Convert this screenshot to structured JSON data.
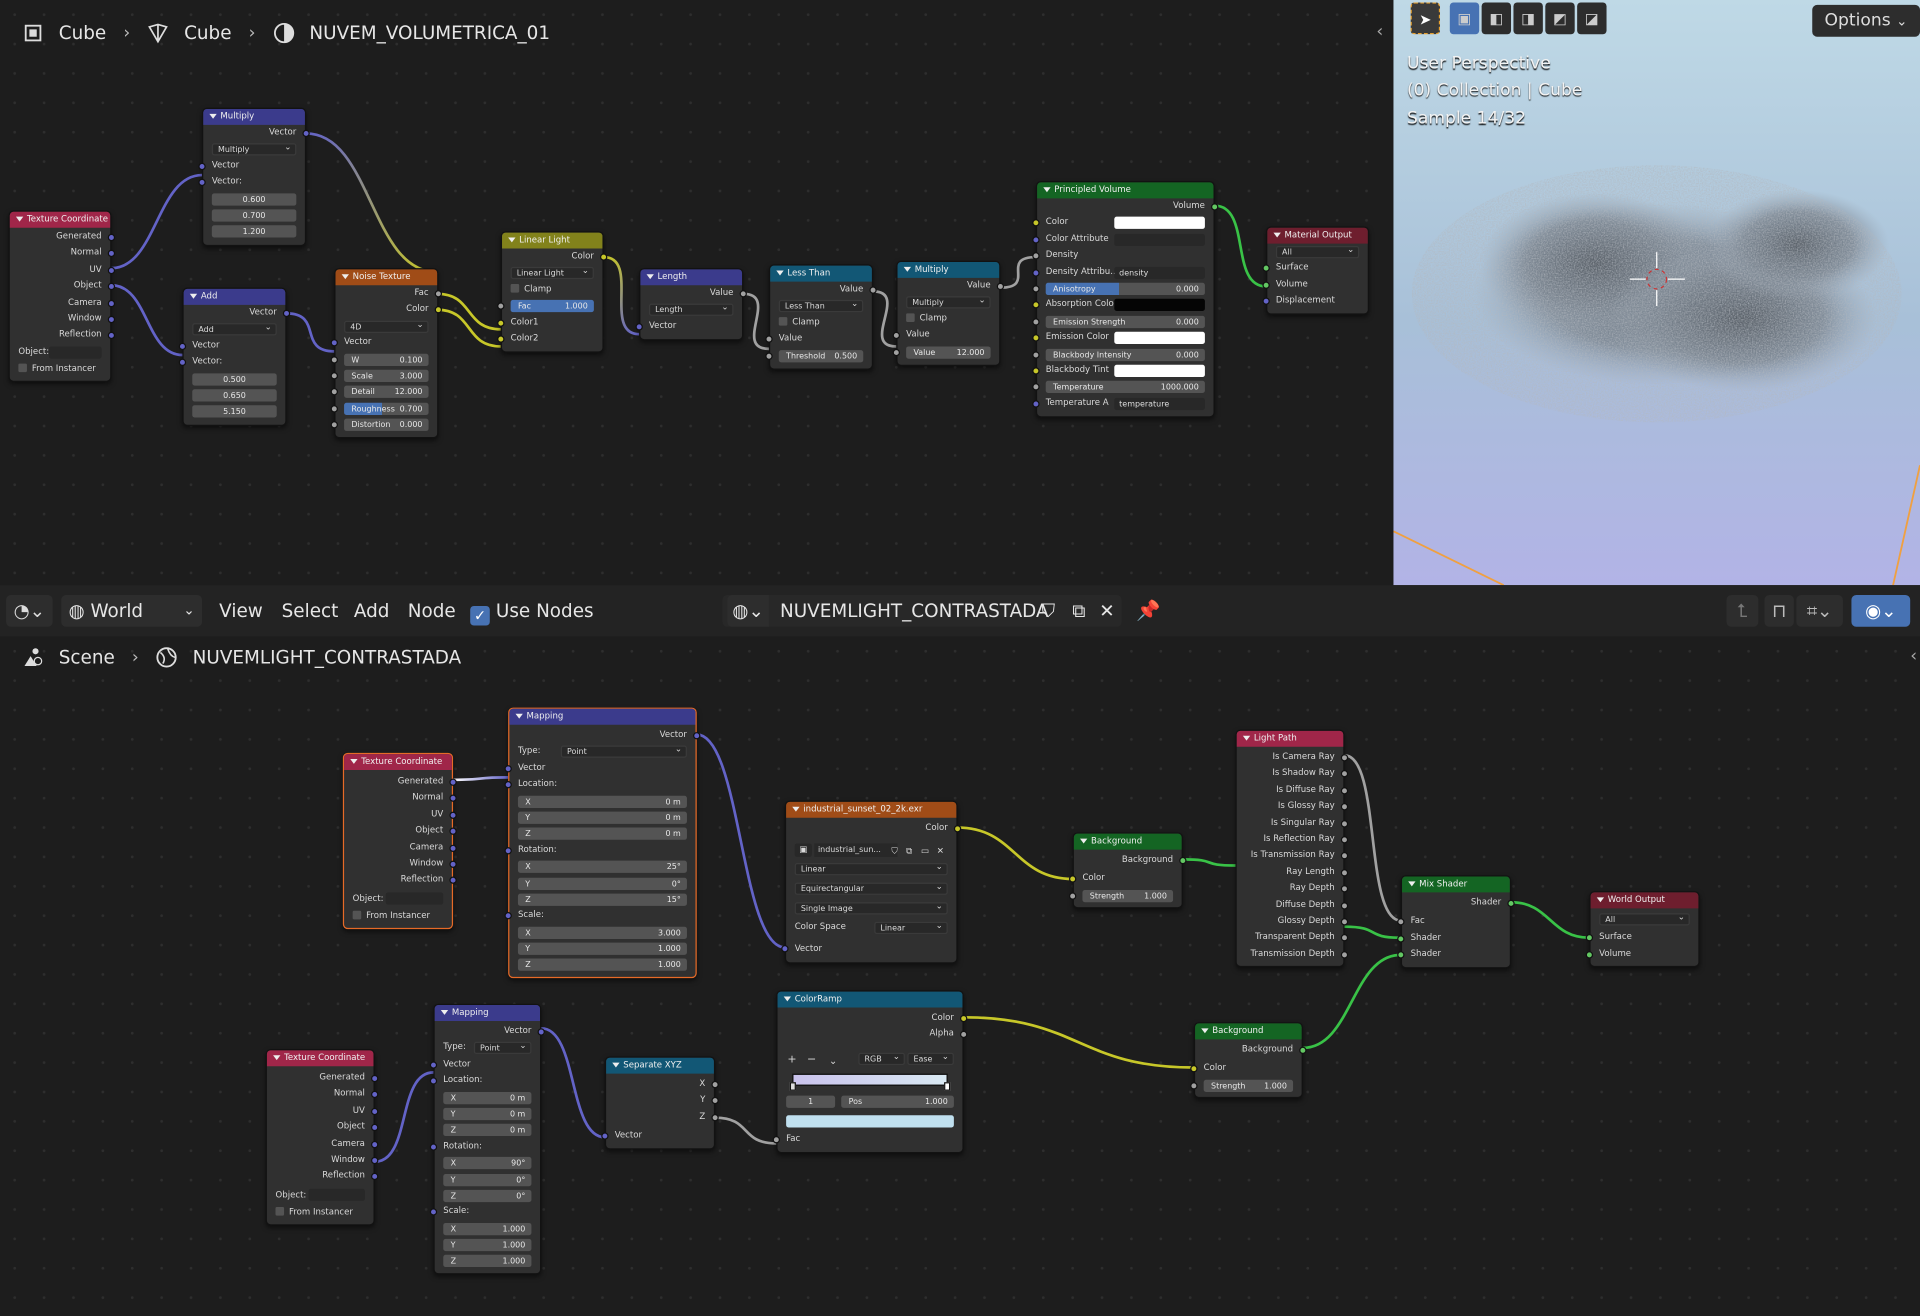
{
  "top_editor": {
    "breadcrumb": [
      "Cube",
      "Cube",
      "NUVEM_VOLUMETRICA_01"
    ],
    "nodes": {
      "tex_coord": {
        "title": "Texture Coordinate",
        "outputs": [
          "Generated",
          "Normal",
          "UV",
          "Object",
          "Camera",
          "Window",
          "Reflection"
        ],
        "object_label": "Object:",
        "from_instancer": "From Instancer"
      },
      "multiply_vec": {
        "title": "Multiply",
        "out": "Vector",
        "op": "Multiply",
        "in_vec": "Vector",
        "vec_label": "Vector:",
        "values": [
          "0.600",
          "0.700",
          "1.200"
        ]
      },
      "add_vec": {
        "title": "Add",
        "out": "Vector",
        "op": "Add",
        "in_vec": "Vector",
        "vec_label": "Vector:",
        "values": [
          "0.500",
          "0.650",
          "5.150"
        ]
      },
      "noise": {
        "title": "Noise Texture",
        "outputs": [
          "Fac",
          "Color"
        ],
        "dim": "4D",
        "in_vec": "Vector",
        "fields": [
          {
            "label": "W",
            "value": "0.100"
          },
          {
            "label": "Scale",
            "value": "3.000"
          },
          {
            "label": "Detail",
            "value": "12.000"
          },
          {
            "label": "Roughness",
            "value": "0.700"
          },
          {
            "label": "Distortion",
            "value": "0.000"
          }
        ]
      },
      "linear_light": {
        "title": "Linear Light",
        "out": "Color",
        "mode": "Linear Light",
        "clamp": "Clamp",
        "fac_label": "Fac",
        "fac_value": "1.000",
        "in1": "Color1",
        "in2": "Color2"
      },
      "length": {
        "title": "Length",
        "out": "Value",
        "op": "Length",
        "in_vec": "Vector"
      },
      "less_than": {
        "title": "Less Than",
        "out": "Value",
        "op": "Less Than",
        "clamp": "Clamp",
        "in_val": "Value",
        "th_label": "Threshold",
        "th_value": "0.500"
      },
      "multiply_math": {
        "title": "Multiply",
        "out": "Value",
        "op": "Multiply",
        "clamp": "Clamp",
        "in_val": "Value",
        "val_label": "Value",
        "val_value": "12.000"
      },
      "principled": {
        "title": "Principled Volume",
        "out": "Volume",
        "color": "Color",
        "color_attr": "Color Attribute",
        "density": "Density",
        "density_attr_label": "Density Attribu...",
        "density_attr_value": "density",
        "anisotropy_label": "Anisotropy",
        "anisotropy_value": "0.000",
        "absorption": "Absorption Colo",
        "emission_strength_label": "Emission Strength",
        "emission_strength_value": "0.000",
        "emission_color": "Emission Color",
        "bb_int_label": "Blackbody Intensity",
        "bb_int_value": "0.000",
        "bb_tint": "Blackbody Tint",
        "temp_label": "Temperature",
        "temp_value": "1000.000",
        "temp_attr_label": "Temperature A",
        "temp_attr_value": "temperature"
      },
      "mat_out": {
        "title": "Material Output",
        "target": "All",
        "inputs": [
          "Surface",
          "Volume",
          "Displacement"
        ]
      }
    }
  },
  "viewport": {
    "perspective": "User Perspective",
    "collection": "(0) Collection | Cube",
    "sample": "Sample 14/32",
    "options": "Options"
  },
  "header": {
    "editor_type": "World",
    "menus": [
      "View",
      "Select",
      "Add",
      "Node"
    ],
    "use_nodes": "Use Nodes",
    "world_name": "NUVEMLIGHT_CONTRASTADA"
  },
  "bottom_editor": {
    "breadcrumb": [
      "Scene",
      "NUVEMLIGHT_CONTRASTADA"
    ],
    "nodes": {
      "tex_coord_a": {
        "title": "Texture Coordinate",
        "outputs": [
          "Generated",
          "Normal",
          "UV",
          "Object",
          "Camera",
          "Window",
          "Reflection"
        ],
        "object_label": "Object:",
        "from_instancer": "From Instancer"
      },
      "mapping_a": {
        "title": "Mapping",
        "out": "Vector",
        "type_label": "Type:",
        "type_value": "Point",
        "in_vec": "Vector",
        "location": "Location:",
        "loc": [
          {
            "axis": "X",
            "v": "0 m"
          },
          {
            "axis": "Y",
            "v": "0 m"
          },
          {
            "axis": "Z",
            "v": "0 m"
          }
        ],
        "rotation": "Rotation:",
        "rot": [
          {
            "axis": "X",
            "v": "25°"
          },
          {
            "axis": "Y",
            "v": "0°"
          },
          {
            "axis": "Z",
            "v": "15°"
          }
        ],
        "scale": "Scale:",
        "scl": [
          {
            "axis": "X",
            "v": "3.000"
          },
          {
            "axis": "Y",
            "v": "1.000"
          },
          {
            "axis": "Z",
            "v": "1.000"
          }
        ]
      },
      "env_tex": {
        "title": "industrial_sunset_02_2k.exr",
        "out": "Color",
        "image": "industrial_sun...",
        "interp": "Linear",
        "proj": "Equirectangular",
        "ext": "Single Image",
        "cs_label": "Color Space",
        "cs_value": "Linear",
        "in_vec": "Vector"
      },
      "background_a": {
        "title": "Background",
        "out": "Background",
        "color": "Color",
        "strength_label": "Strength",
        "strength_value": "1.000"
      },
      "light_path": {
        "title": "Light Path",
        "outputs": [
          "Is Camera Ray",
          "Is Shadow Ray",
          "Is Diffuse Ray",
          "Is Glossy Ray",
          "Is Singular Ray",
          "Is Reflection Ray",
          "Is Transmission Ray",
          "Ray Length",
          "Ray Depth",
          "Diffuse Depth",
          "Glossy Depth",
          "Transparent Depth",
          "Transmission Depth"
        ]
      },
      "mix_shader": {
        "title": "Mix Shader",
        "out": "Shader",
        "inputs": [
          "Fac",
          "Shader",
          "Shader"
        ]
      },
      "world_out": {
        "title": "World Output",
        "target": "All",
        "inputs": [
          "Surface",
          "Volume"
        ]
      },
      "tex_coord_b": {
        "title": "Texture Coordinate",
        "outputs": [
          "Generated",
          "Normal",
          "UV",
          "Object",
          "Camera",
          "Window",
          "Reflection"
        ],
        "object_label": "Object:",
        "from_instancer": "From Instancer"
      },
      "mapping_b": {
        "title": "Mapping",
        "out": "Vector",
        "type_label": "Type:",
        "type_value": "Point",
        "in_vec": "Vector",
        "location": "Location:",
        "loc": [
          {
            "axis": "X",
            "v": "0 m"
          },
          {
            "axis": "Y",
            "v": "0 m"
          },
          {
            "axis": "Z",
            "v": "0 m"
          }
        ],
        "rotation": "Rotation:",
        "rot": [
          {
            "axis": "X",
            "v": "90°"
          },
          {
            "axis": "Y",
            "v": "0°"
          },
          {
            "axis": "Z",
            "v": "0°"
          }
        ],
        "scale": "Scale:",
        "scl": [
          {
            "axis": "X",
            "v": "1.000"
          },
          {
            "axis": "Y",
            "v": "1.000"
          },
          {
            "axis": "Z",
            "v": "1.000"
          }
        ]
      },
      "separate_xyz": {
        "title": "Separate XYZ",
        "outputs": [
          "X",
          "Y",
          "Z"
        ],
        "in_vec": "Vector"
      },
      "color_ramp": {
        "title": "ColorRamp",
        "outputs": [
          "Color",
          "Alpha"
        ],
        "mode": "RGB",
        "interp": "Ease",
        "index": "1",
        "pos_label": "Pos",
        "pos_value": "1.000",
        "in_fac": "Fac"
      },
      "background_b": {
        "title": "Background",
        "out": "Background",
        "color": "Color",
        "strength_label": "Strength",
        "strength_value": "1.000"
      }
    }
  },
  "colors": {
    "vector_socket": "#6363c7",
    "color_socket": "#c7c729",
    "shader_socket": "#63c763",
    "float_socket": "#a1a1a1",
    "selected_outline": "#e66a27"
  }
}
